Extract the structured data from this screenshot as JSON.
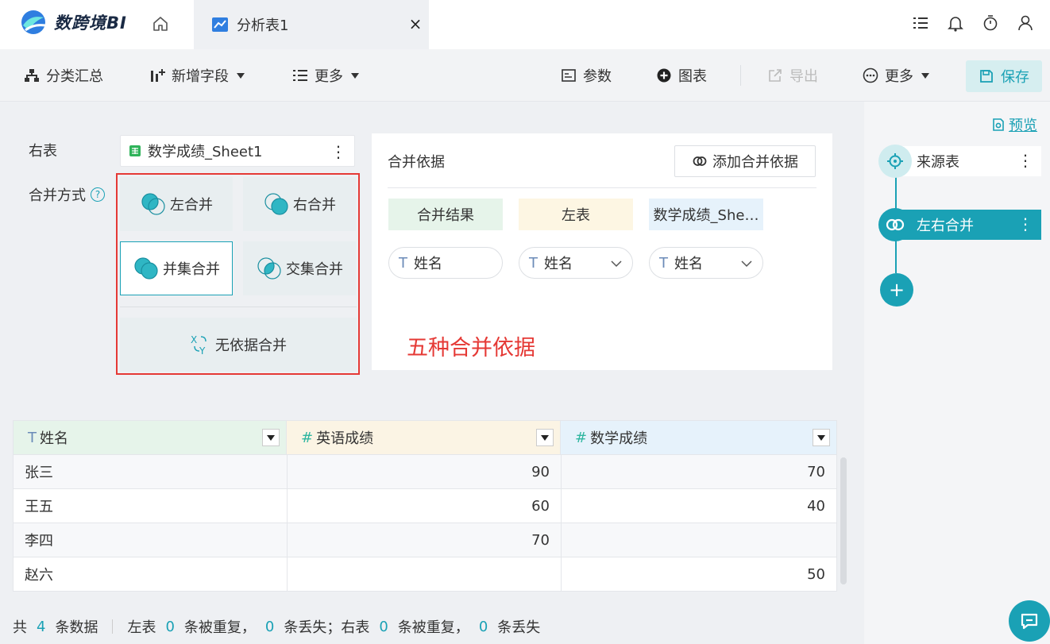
{
  "app": {
    "name": "数跨境BI"
  },
  "tab": {
    "label": "分析表1",
    "close": "×"
  },
  "toolbar": {
    "group_summary": "分类汇总",
    "add_field": "新增字段",
    "more_left": "更多",
    "params": "参数",
    "chart": "图表",
    "export": "导出",
    "more_right": "更多",
    "save": "保存"
  },
  "config": {
    "right_table_label": "右表",
    "right_table_value": "数学成绩_Sheet1",
    "merge_mode_label": "合并方式",
    "help_symbol": "?",
    "options": [
      "左合并",
      "右合并",
      "并集合并",
      "交集合并",
      "无依据合并"
    ],
    "selected_option": "并集合并"
  },
  "basis": {
    "title": "合并依据",
    "add_button": "添加合并依据",
    "columns": [
      "合并结果",
      "左表",
      "数学成绩_She…"
    ],
    "fields": [
      "姓名",
      "姓名",
      "姓名"
    ],
    "type_glyph": "T"
  },
  "annotation": "五种合并依据",
  "table": {
    "columns": [
      {
        "glyph": "T",
        "label": "姓名"
      },
      {
        "glyph": "#",
        "label": "英语成绩"
      },
      {
        "glyph": "#",
        "label": "数学成绩"
      }
    ],
    "rows": [
      [
        "张三",
        "90",
        "70"
      ],
      [
        "王五",
        "60",
        "40"
      ],
      [
        "李四",
        "70",
        ""
      ],
      [
        "赵六",
        "",
        "50"
      ]
    ]
  },
  "footer": {
    "total_prefix": "共",
    "total": "4",
    "total_suffix": "条数据",
    "left_prefix": "左表",
    "left_dup": "0",
    "left_dup_suffix": "条被重复，",
    "left_lost": "0",
    "left_lost_suffix": "条丢失；右表",
    "right_dup": "0",
    "right_dup_suffix": "条被重复，",
    "right_lost": "0",
    "right_lost_suffix": "条丢失"
  },
  "flow": {
    "preview": "预览",
    "source_node": "来源表",
    "merge_node": "左右合并",
    "add_symbol": "+"
  },
  "colors": {
    "accent": "#1aa1b5",
    "annotation": "#e53935",
    "selection_box": "#e53935"
  }
}
